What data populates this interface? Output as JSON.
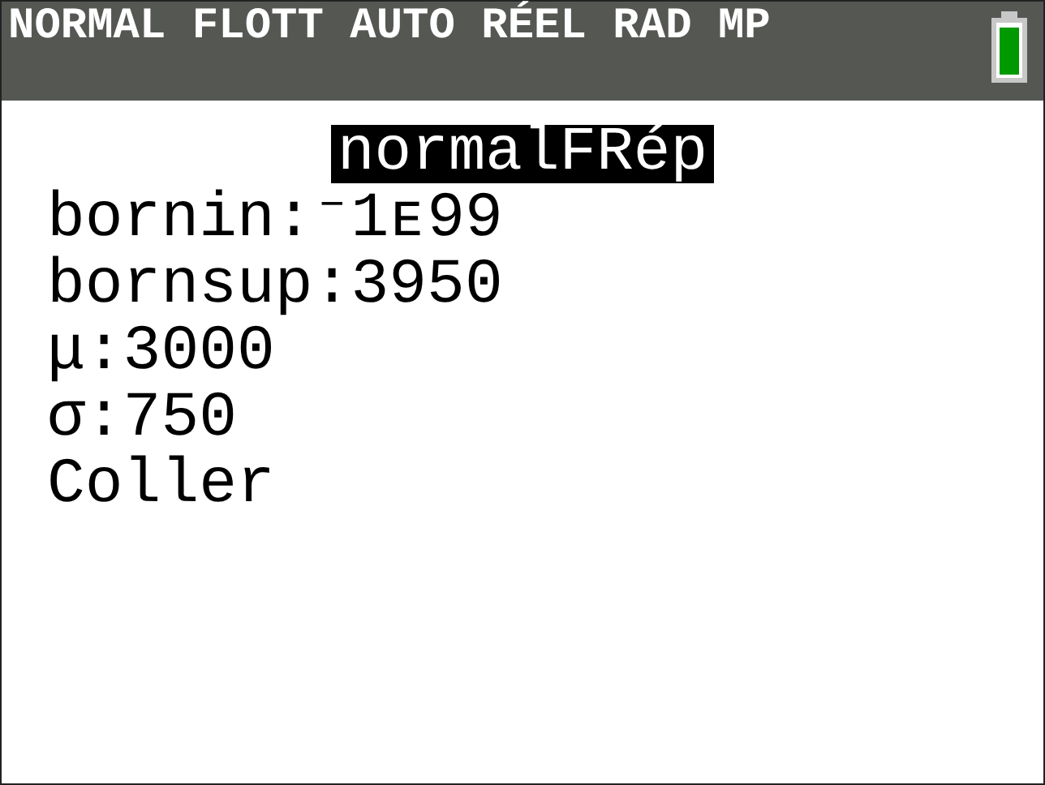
{
  "status_bar": {
    "modes": "NORMAL FLOTT AUTO RÉEL RAD MP"
  },
  "screen": {
    "title": "normalFRép",
    "lines": [
      {
        "label": "bornin:",
        "value": "⁻1ᴇ99"
      },
      {
        "label": "bornsup:",
        "value": "3950"
      },
      {
        "label": "μ:",
        "value": "3000"
      },
      {
        "label": "σ:",
        "value": "750"
      },
      {
        "label": "Coller"
      }
    ]
  }
}
